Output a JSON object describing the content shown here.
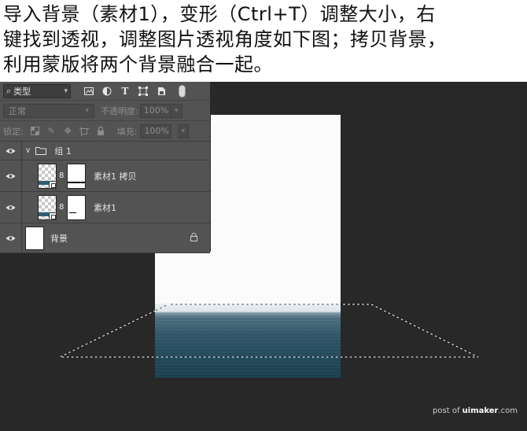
{
  "instruction": {
    "line1": "导入背景（素材1），变形（Ctrl+T）调整大小，右",
    "line2": "键找到透视，调整图片透视角度如下图；拷贝背景，",
    "line3": "利用蒙版将两个背景融合一起。"
  },
  "layers_panel": {
    "filter_label": "类型",
    "blend_mode": "正常",
    "opacity_label": "不透明度:",
    "opacity_value": "100%",
    "lock_label": "锁定:",
    "fill_label": "填充:",
    "fill_value": "100%",
    "group": {
      "name": "组 1"
    },
    "layers": [
      {
        "name": "素材1 拷贝"
      },
      {
        "name": "素材1"
      }
    ],
    "background": {
      "name": "背景"
    }
  },
  "watermark": {
    "prefix": "post of ",
    "site": "uimaker",
    "suffix": ".com"
  },
  "icons": [
    "search-icon",
    "image-filter-icon",
    "adjustment-filter-icon",
    "type-filter-icon",
    "shape-filter-icon",
    "smart-object-filter-icon",
    "filter-toggle-icon",
    "eye-icon",
    "folder-icon",
    "chain-link-icon",
    "lock-icon"
  ]
}
